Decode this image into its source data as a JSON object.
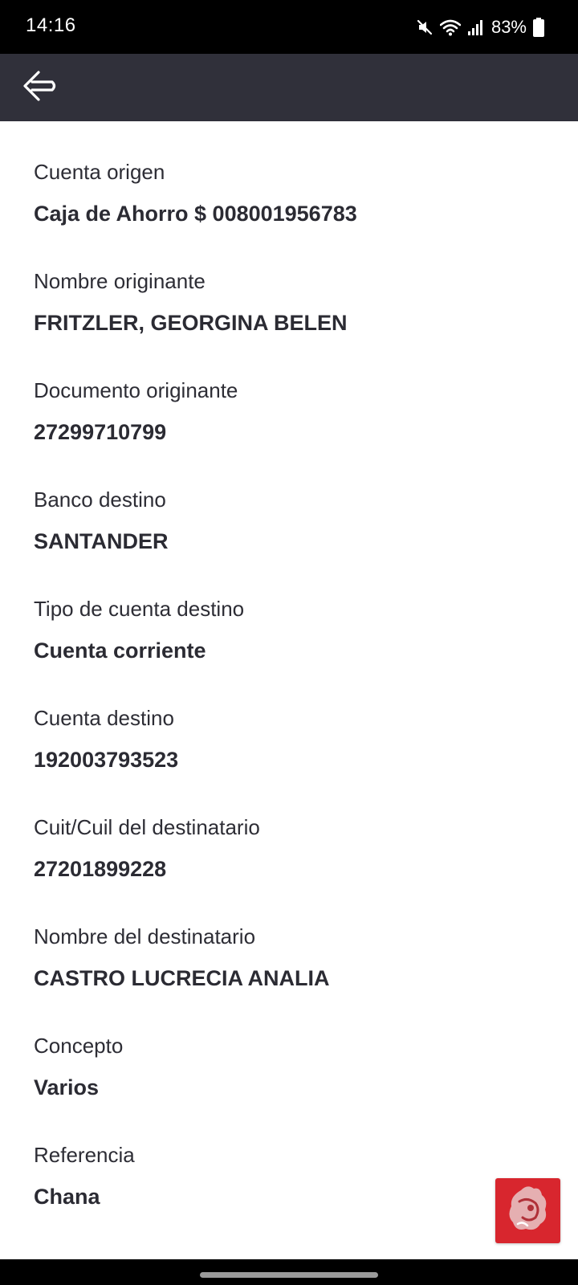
{
  "status_bar": {
    "time": "14:16",
    "battery": "83%",
    "icons": [
      "mute-icon",
      "wifi-icon",
      "signal-icon",
      "battery-icon"
    ]
  },
  "app_bar": {
    "back_icon": "arrow-left-icon",
    "background_color": "#30303a"
  },
  "fields": [
    {
      "label": "Cuenta origen",
      "value": "Caja de Ahorro $ 008001956783"
    },
    {
      "label": "Nombre originante",
      "value": "FRITZLER, GEORGINA BELEN"
    },
    {
      "label": "Documento originante",
      "value": "27299710799"
    },
    {
      "label": "Banco destino",
      "value": "SANTANDER"
    },
    {
      "label": "Tipo de cuenta destino",
      "value": "Cuenta corriente"
    },
    {
      "label": "Cuenta destino",
      "value": "192003793523"
    },
    {
      "label": "Cuit/Cuil del destinatario",
      "value": "27201899228"
    },
    {
      "label": "Nombre del destinatario",
      "value": "CASTRO LUCRECIA ANALIA"
    },
    {
      "label": "Concepto",
      "value": "Varios"
    },
    {
      "label": "Referencia",
      "value": "Chana"
    }
  ],
  "fab": {
    "icon": "assistant-icon",
    "color": "#d8262e"
  }
}
